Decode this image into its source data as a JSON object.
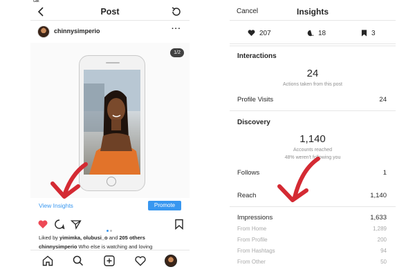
{
  "left": {
    "status_text": "Glik",
    "header": {
      "title": "Post"
    },
    "post": {
      "username": "chinnysimperio",
      "counter": "1/2",
      "view_insights": "View Insights",
      "promote": "Promote",
      "likes_prefix": "Liked by",
      "likes_names": "yimimka, olubusi_o",
      "likes_and": "and",
      "likes_others": "205 others",
      "caption_user": "chinnysimperio",
      "caption_text": "Who else is watching and loving"
    }
  },
  "right": {
    "header": {
      "cancel": "Cancel",
      "title": "Insights"
    },
    "stats": {
      "likes": "207",
      "comments": "18",
      "saves": "3"
    },
    "interactions": {
      "title": "Interactions",
      "actions_value": "24",
      "actions_note": "Actions taken from this post",
      "profile_visits_label": "Profile Visits",
      "profile_visits_value": "24"
    },
    "discovery": {
      "title": "Discovery",
      "reached_value": "1,140",
      "reached_note": "Accounts reached",
      "not_following_note": "48% weren't following you",
      "follows_label": "Follows",
      "follows_value": "1",
      "reach_label": "Reach",
      "reach_value": "1,140",
      "impressions_label": "Impressions",
      "impressions_value": "1,633",
      "sources": [
        {
          "label": "From Home",
          "value": "1,289"
        },
        {
          "label": "From Profile",
          "value": "200"
        },
        {
          "label": "From Hashtags",
          "value": "94"
        },
        {
          "label": "From Other",
          "value": "50"
        }
      ]
    }
  },
  "colors": {
    "accent": "#3897f0",
    "like": "#ed4956",
    "annotation_arrow": "#d42a33"
  }
}
